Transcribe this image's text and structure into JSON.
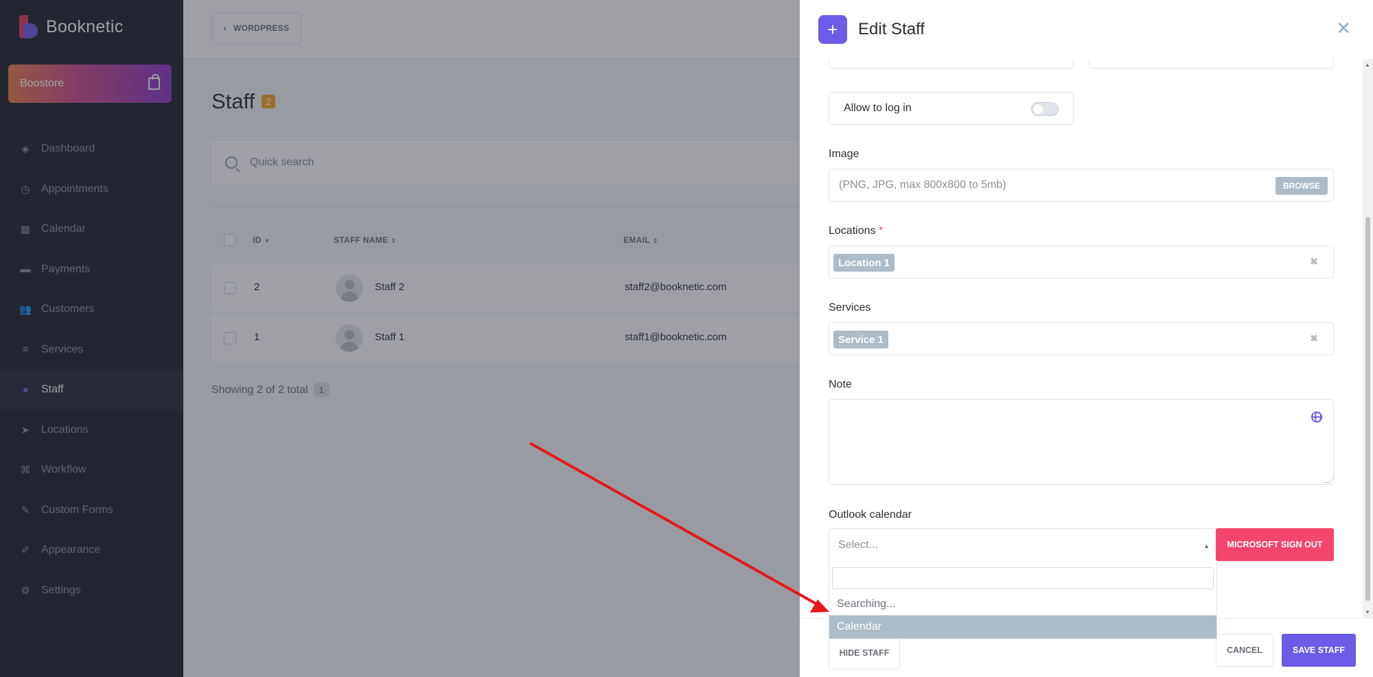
{
  "sidebar": {
    "brand": "Booknetic",
    "boostore_label": "Boostore",
    "items": [
      {
        "label": "Dashboard",
        "icon": "dashboard-icon",
        "glyph": "◈"
      },
      {
        "label": "Appointments",
        "icon": "clock-icon",
        "glyph": "◷"
      },
      {
        "label": "Calendar",
        "icon": "calendar-icon",
        "glyph": "▦"
      },
      {
        "label": "Payments",
        "icon": "wallet-icon",
        "glyph": "▬"
      },
      {
        "label": "Customers",
        "icon": "users-icon",
        "glyph": "👥"
      },
      {
        "label": "Services",
        "icon": "list-icon",
        "glyph": "≡"
      },
      {
        "label": "Staff",
        "icon": "user-icon",
        "glyph": "●",
        "active": true
      },
      {
        "label": "Locations",
        "icon": "location-arrow-icon",
        "glyph": "➤"
      },
      {
        "label": "Workflow",
        "icon": "workflow-icon",
        "glyph": "⌘"
      },
      {
        "label": "Custom Forms",
        "icon": "magic-wand-icon",
        "glyph": "✎"
      },
      {
        "label": "Appearance",
        "icon": "brush-icon",
        "glyph": "✐"
      },
      {
        "label": "Settings",
        "icon": "gear-icon",
        "glyph": "⚙"
      }
    ]
  },
  "header": {
    "wordpress_label": "WORDPRESS"
  },
  "page": {
    "title": "Staff",
    "count": "2",
    "search_placeholder": "Quick search",
    "columns": {
      "id": "ID",
      "name": "STAFF NAME",
      "email": "EMAIL"
    },
    "rows": [
      {
        "id": "2",
        "name": "Staff 2",
        "email": "staff2@booknetic.com"
      },
      {
        "id": "1",
        "name": "Staff 1",
        "email": "staff1@booknetic.com"
      }
    ],
    "showing": "Showing 2 of 2 total",
    "page_number": "1"
  },
  "panel": {
    "title": "Edit Staff",
    "allow_login_label": "Allow to log in",
    "allow_login_enabled": false,
    "image_label": "Image",
    "image_placeholder": "(PNG, JPG, max 800x800 to 5mb)",
    "browse_label": "BROWSE",
    "locations_label": "Locations",
    "required_mark": "*",
    "location_tag": "Location 1",
    "services_label": "Services",
    "service_tag": "Service 1",
    "note_label": "Note",
    "outlook_label": "Outlook calendar",
    "outlook_select_placeholder": "Select...",
    "ms_signout_label": "MICROSOFT SIGN OUT",
    "dropdown_searching": "Searching...",
    "dropdown_option": "Calendar",
    "hide_label": "HIDE STAFF",
    "cancel_label": "CANCEL",
    "save_label": "SAVE STAFF"
  },
  "colors": {
    "accent": "#6c5ce7",
    "danger": "#f4466c",
    "badge": "#f5a623",
    "annotation_arrow": "#e8161b"
  }
}
